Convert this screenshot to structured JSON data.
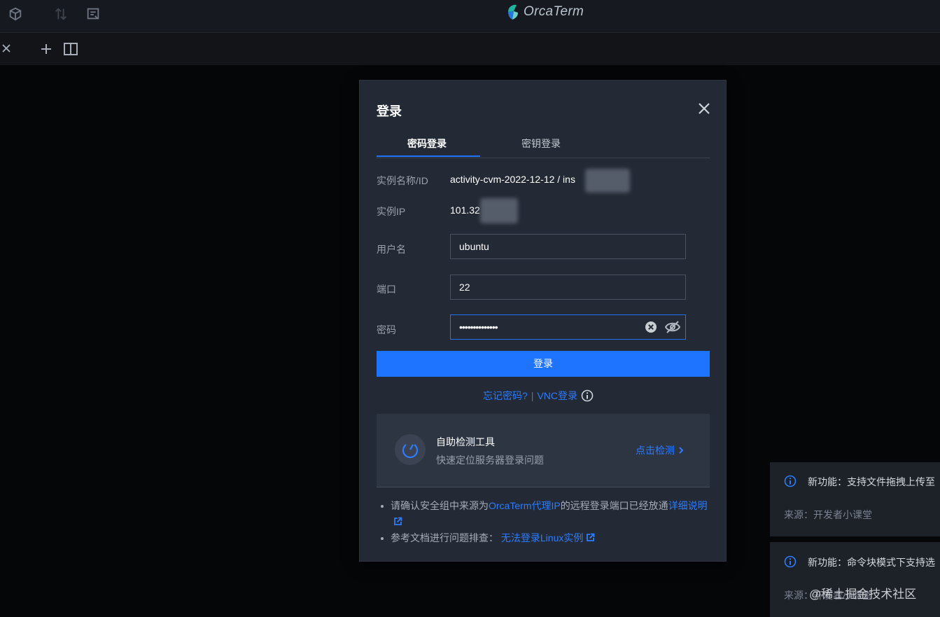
{
  "app": {
    "brand": "OrcaTerm"
  },
  "titlebar": {
    "icons": [
      "cube-icon",
      "transfer-icon",
      "terminal-list-icon"
    ]
  },
  "tabbar": {
    "icons": [
      "close-icon",
      "add-tab-icon",
      "split-view-icon"
    ]
  },
  "dialog": {
    "title": "登录",
    "tabs": [
      {
        "label": "密码登录",
        "active": true
      },
      {
        "label": "密钥登录",
        "active": false
      }
    ],
    "instance_name_label": "实例名称/ID",
    "instance_name_value": "activity-cvm-2022-12-12 / ins",
    "instance_ip_label": "实例IP",
    "instance_ip_value": "101.32",
    "username_label": "用户名",
    "username_value": "ubuntu",
    "port_label": "端口",
    "port_value": "22",
    "password_label": "密码",
    "password_mask": "••••••••••••••",
    "login_button": "登录",
    "forgot_password": "忘记密码?",
    "separator": "|",
    "vnc_login": "VNC登录",
    "tool": {
      "title": "自助检测工具",
      "subtitle": "快速定位服务器登录问题",
      "action": "点击检测"
    },
    "notes": {
      "note1_prefix": "请确认安全组中来源为",
      "note1_link": "OrcaTerm代理IP",
      "note1_middle": "的远程登录端口已经放通",
      "note1_link2": "详细说明",
      "note2_prefix": "参考文档进行问题排查：",
      "note2_link": "无法登录Linux实例"
    }
  },
  "toasts": [
    {
      "title": "新功能：支持文件拖拽上传至",
      "source": "来源：开发者小课堂"
    },
    {
      "title": "新功能：命令块模式下支持选",
      "source": "来源：开发者小课堂"
    }
  ],
  "watermark": "@稀土掘金技术社区",
  "colors": {
    "accent": "#1e74ff",
    "link": "#2d7cff",
    "dialog_bg": "#232a35",
    "background": "#050608"
  }
}
